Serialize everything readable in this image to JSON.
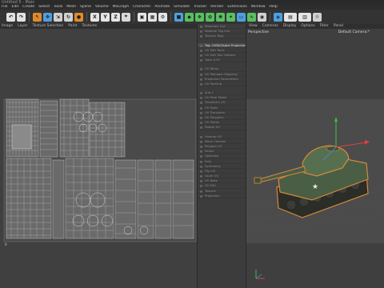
{
  "window": {
    "title": "Untitled 5 - Main"
  },
  "menubar": [
    "File",
    "Edit",
    "Create",
    "Select",
    "Tools",
    "Mesh",
    "Spline",
    "Volume",
    "MoGraph",
    "Character",
    "Animate",
    "Simulate",
    "Tracker",
    "Render",
    "Extensions",
    "Window",
    "Help"
  ],
  "uv_editor": {
    "menu": [
      "Image",
      "Layer",
      "Texture Selection",
      "Paint",
      "Textures"
    ]
  },
  "attributes": {
    "items": [
      "Materials List",
      "Material Tag Info",
      "Texture Tags",
      "",
      "Tag: UVW/Object Projection",
      "UV Edit Tools",
      "UV Edit Tool Options",
      "Tools (UV)",
      "",
      "UV Relax",
      "UV Manager Mapping",
      "Projection Parameters",
      "UV Packing",
      "",
      "Sub 1",
      "UV Pixel Mode",
      "Transform UV",
      "UV Tools",
      "UV Transform",
      "UV Polygons",
      "UV Points",
      "Rotate UV",
      "",
      "Unwrap UV",
      "Mesh Checker",
      "Polygon UV",
      "Select",
      "Optimize",
      "Solo",
      "Symmetry",
      "Flip UV",
      "Layer UV",
      "UV Bake",
      "UV Edit",
      "Texture",
      "Projection"
    ],
    "highlight_index": 4
  },
  "viewport": {
    "menu": [
      "View",
      "Cameras",
      "Display",
      "Options",
      "Filter",
      "Panel"
    ],
    "perspective_label": "Perspective",
    "camera_label": "Default Camera:*"
  },
  "colors": {
    "accent_orange": "#e08a2a",
    "tank_green": "#4a5e45",
    "selection_outline": "#d9883a"
  }
}
